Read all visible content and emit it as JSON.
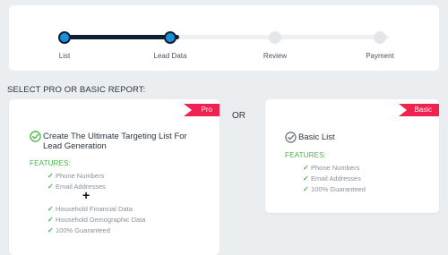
{
  "stepper": {
    "steps": [
      {
        "label": "List",
        "state": "done"
      },
      {
        "label": "Lead Data",
        "state": "done"
      },
      {
        "label": "Review",
        "state": "todo"
      },
      {
        "label": "Payment",
        "state": "todo"
      }
    ],
    "colors": {
      "active": "#1b8fdc",
      "track": "#0e1f33",
      "inactive": "#e4e7ea"
    }
  },
  "section_title": "SELECT PRO OR BASIC REPORT:",
  "or_label": "OR",
  "pro": {
    "badge": "Pro",
    "title_line1": "Create The Ultimate Targeting List For",
    "title_line2": "Lead Generation",
    "features_label": "FEATURES:",
    "features_top": [
      "Phone Numbers",
      "Email Addresses"
    ],
    "plus": "+",
    "features_bottom": [
      "Household Financial Data",
      "Household Demographic Data",
      "100% Guaranteed"
    ],
    "selected": true
  },
  "basic": {
    "badge": "Basic",
    "title": "Basic List",
    "features_label": "FEATURES:",
    "features": [
      "Phone Numbers",
      "Email Addresses",
      "100% Guaranteed"
    ],
    "selected": false
  },
  "colors": {
    "badge": "#f0224f",
    "check": "#4ab54a",
    "check_unselected": "#6b7a8a"
  }
}
